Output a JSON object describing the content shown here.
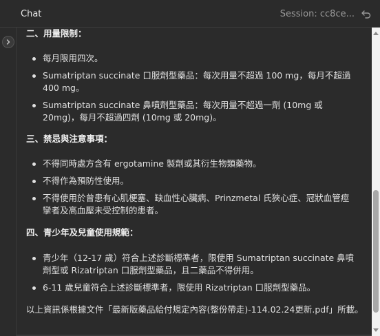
{
  "header": {
    "title": "Chat",
    "session": "Session: cc8ce..."
  },
  "content": {
    "section2": {
      "heading": "二、用量限制：",
      "items": [
        "每月限用四次。",
        "Sumatriptan succinate 口服劑型藥品：每次用量不超過 100 mg，每月不超過 400 mg。",
        "Sumatriptan succinate 鼻噴劑型藥品：每次用量不超過一劑 (10mg 或 20mg)，每月不超過四劑 (10mg 或 20mg)。"
      ]
    },
    "section3": {
      "heading": "三、禁忌與注意事項：",
      "items": [
        "不得同時處方含有 ergotamine 製劑或其衍生物類藥物。",
        "不得作為預防性使用。",
        "不得使用於曾患有心肌梗塞、缺血性心臟病、Prinzmetal 氏狹心症、冠狀血管痙攣者及高血壓未受控制的患者。"
      ]
    },
    "section4": {
      "heading": "四、青少年及兒童使用規範：",
      "items": [
        "青少年（12-17 歲）符合上述診斷標準者，限使用 Sumatriptan succinate 鼻噴劑型或 Rizatriptan 口服劑型藥品，且二藥品不得併用。",
        "6-11 歲兒童符合上述診斷標準者，限使用 Rizatriptan 口服劑型藥品。"
      ]
    },
    "footer": "以上資訊係根據文件「最新版藥品給付規定內容(整份帶走)-114.02.24更新.pdf」所載。"
  },
  "icons": {
    "back": "undo-arrow-icon",
    "expand": "chevron-right-icon"
  },
  "colors": {
    "background": "#2b2b2b",
    "text": "#e0e0e0",
    "muted": "#9a9a9a",
    "scrollbar_track": "#f2f2f2"
  }
}
